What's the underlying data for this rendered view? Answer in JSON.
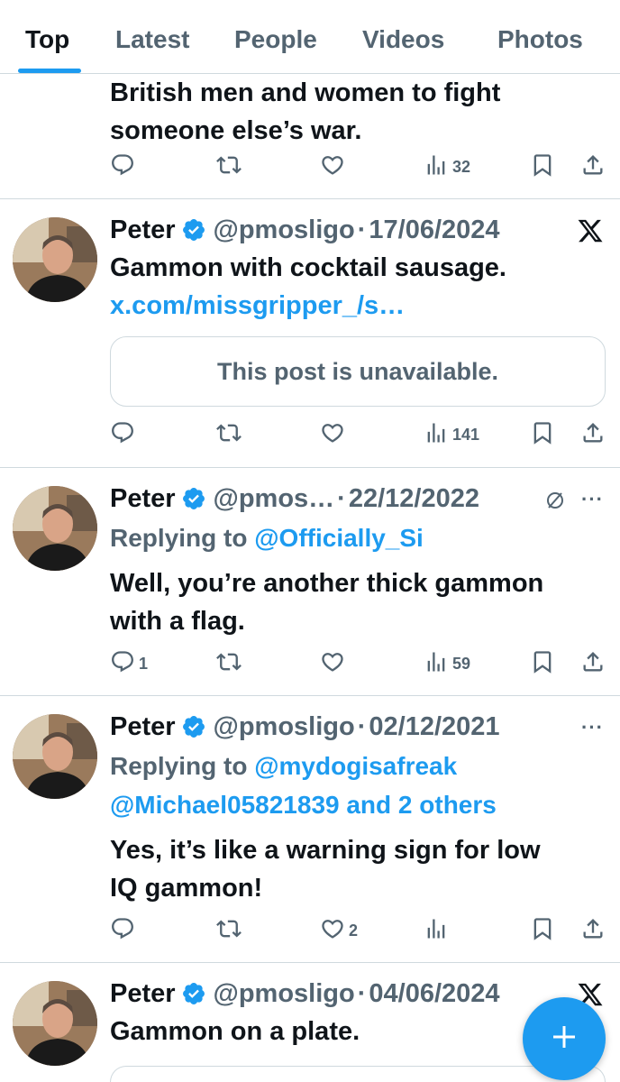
{
  "tabs": [
    {
      "label": "Top",
      "active": true
    },
    {
      "label": "Latest"
    },
    {
      "label": "People"
    },
    {
      "label": "Videos"
    },
    {
      "label": "Photos"
    }
  ],
  "tweets": [
    {
      "text_lines": [
        "British men and women to fight",
        "someone else’s war."
      ],
      "actions": {
        "replies": "",
        "reposts": "",
        "likes": "",
        "views": "32"
      }
    },
    {
      "name": "Peter",
      "handle": "@pmosligo",
      "date": "17/06/2024",
      "corner": "x-logo-icon",
      "text": "Gammon with cocktail sausage.",
      "link": "x.com/missgripper_/s…",
      "quote": "This post is unavailable.",
      "actions": {
        "replies": "",
        "reposts": "",
        "likes": "",
        "views": "141"
      }
    },
    {
      "name": "Peter",
      "handle": "@pmos…",
      "date": "22/12/2022",
      "corner": "more-icon",
      "replying_prefix": "Replying to ",
      "replying_to": "@Officially_Si",
      "text_lines": [
        "Well, you’re another thick gammon",
        "with a flag."
      ],
      "actions": {
        "replies": "1",
        "reposts": "",
        "likes": "",
        "views": "59"
      }
    },
    {
      "name": "Peter",
      "handle": "@pmosligo",
      "date": "02/12/2021",
      "corner": "more-icon",
      "replying_prefix": "Replying to ",
      "replying_to": "@mydogisafreak",
      "replying_to_2": "@Michael05821839 and 2 others",
      "text_lines": [
        "Yes, it’s like a warning sign for low",
        "IQ gammon!"
      ],
      "actions": {
        "replies": "",
        "reposts": "",
        "likes": "2",
        "views": ""
      }
    },
    {
      "name": "Peter",
      "handle": "@pmosligo",
      "date": "04/06/2024",
      "corner": "x-logo-icon",
      "text": "Gammon on a plate."
    }
  ],
  "more_glyph": "···",
  "colors": {
    "accent": "#1d9bf0",
    "muted": "#536471",
    "text": "#0f1419",
    "border": "#cfd9de"
  }
}
